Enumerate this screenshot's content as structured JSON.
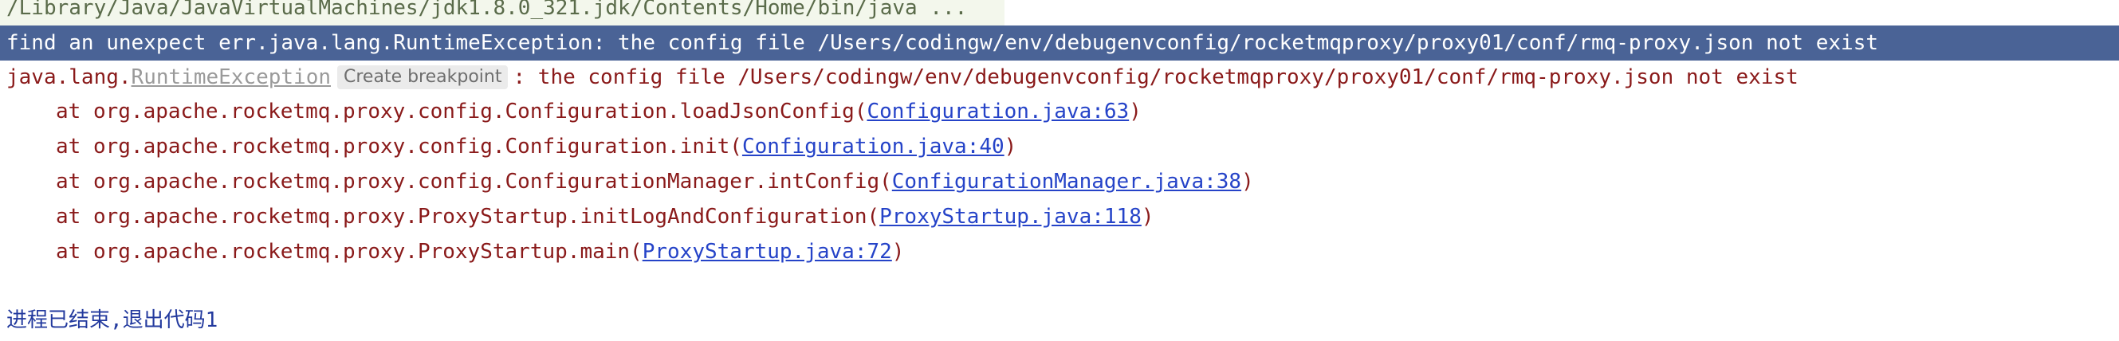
{
  "console": {
    "command_line": "/Library/Java/JavaVirtualMachines/jdk1.8.0_321.jdk/Contents/Home/bin/java ...",
    "selected_line": "find an unexpect err.java.lang.RuntimeException: the config file /Users/codingw/env/debugenvconfig/rocketmqproxy/proxy01/conf/rmq-proxy.json not exist",
    "exception": {
      "package_prefix": "java.lang.",
      "class_name": "RuntimeException",
      "breakpoint_hint": "Create breakpoint",
      "message": ": the config file /Users/codingw/env/debugenvconfig/rocketmqproxy/proxy01/conf/rmq-proxy.json not exist"
    },
    "stack_frames": [
      {
        "prefix": "at org.apache.rocketmq.proxy.config.Configuration.loadJsonConfig(",
        "link": "Configuration.java:63",
        "suffix": ")"
      },
      {
        "prefix": "at org.apache.rocketmq.proxy.config.Configuration.init(",
        "link": "Configuration.java:40",
        "suffix": ")"
      },
      {
        "prefix": "at org.apache.rocketmq.proxy.config.ConfigurationManager.intConfig(",
        "link": "ConfigurationManager.java:38",
        "suffix": ")"
      },
      {
        "prefix": "at org.apache.rocketmq.proxy.ProxyStartup.initLogAndConfiguration(",
        "link": "ProxyStartup.java:118",
        "suffix": ")"
      },
      {
        "prefix": "at org.apache.rocketmq.proxy.ProxyStartup.main(",
        "link": "ProxyStartup.java:72",
        "suffix": ")"
      }
    ],
    "exit_message": "进程已结束,退出代码1"
  },
  "colors": {
    "selection_background": "#4a6396",
    "error_text": "#8a1a1a",
    "link": "#2543c8",
    "exit_text": "#233a9e"
  }
}
